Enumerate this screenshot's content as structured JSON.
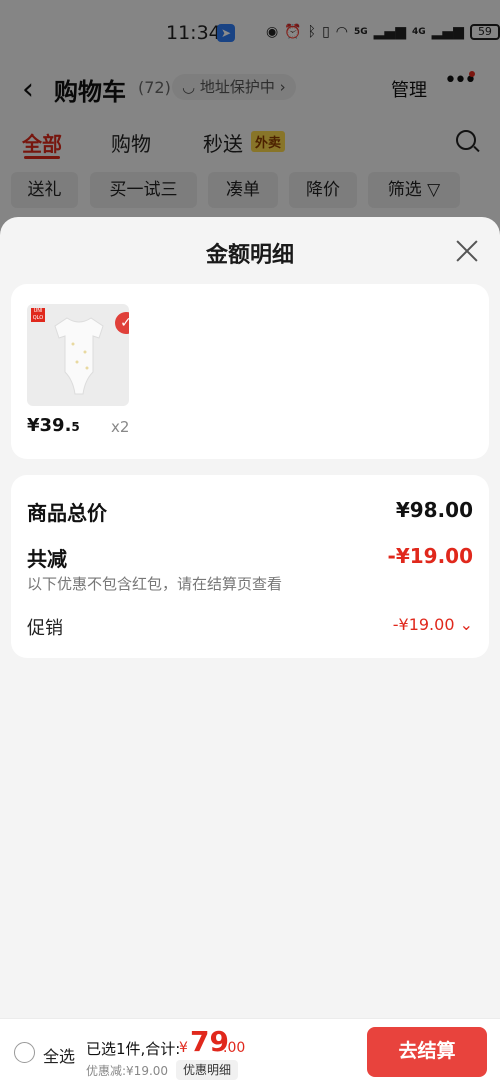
{
  "status_bar": {
    "time": "11:34",
    "battery": "59",
    "net1": "5G",
    "net2": "4G"
  },
  "header": {
    "title": "购物车",
    "count": "(72)",
    "address_protect": "地址保护中",
    "manage": "管理"
  },
  "tabs": [
    {
      "label": "全部"
    },
    {
      "label": "购物"
    },
    {
      "label": "秒送"
    }
  ],
  "tab_tag": "外卖",
  "filters": [
    {
      "label": "送礼"
    },
    {
      "label": "买一试三"
    },
    {
      "label": "凑单"
    },
    {
      "label": "降价"
    },
    {
      "label": "筛选"
    }
  ],
  "sheet": {
    "title": "金额明细",
    "product": {
      "brand_logo": "UNI QLO",
      "price_main": "¥39.",
      "price_dec": "5",
      "qty": "x2"
    },
    "summary": {
      "total_label": "商品总价",
      "total_value": "¥98.00",
      "reduce_label": "共减",
      "reduce_value": "-¥19.00",
      "note": "以下优惠不包含红包，请在结算页查看",
      "promo_label": "促销",
      "promo_value": "-¥19.00"
    }
  },
  "bottom_bar": {
    "select_all": "全选",
    "selected_text": "已选1件,合计:",
    "currency": "¥",
    "total_int": "79",
    "total_dec": ".00",
    "discount": "优惠减:¥19.00",
    "detail_btn": "优惠明细",
    "checkout": "去结算"
  },
  "colors": {
    "accent": "#e0281c",
    "checkout_bg": "#e8433d",
    "tag_bg": "#f7d54c"
  }
}
